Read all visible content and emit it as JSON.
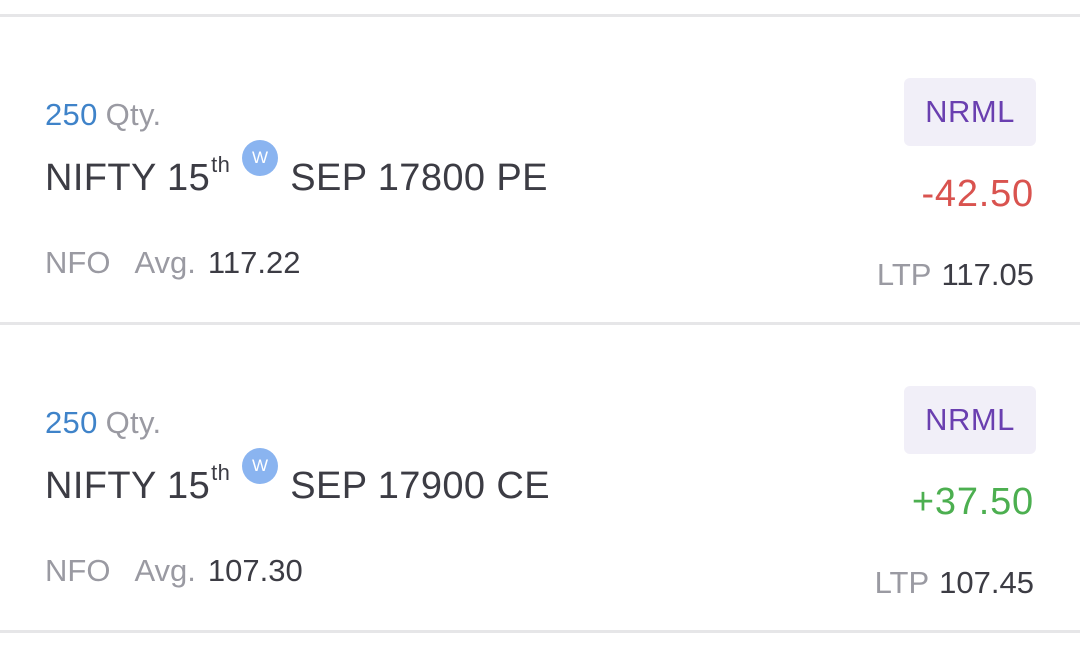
{
  "positions": [
    {
      "qty": "250",
      "qty_unit": "Qty.",
      "symbol": "NIFTY 15",
      "symbol_sup": "th",
      "weekly_badge": "W",
      "contract": "SEP 17800 PE",
      "exchange": "NFO",
      "avg_label": "Avg.",
      "avg_value": "117.22",
      "product": "NRML",
      "pnl": "-42.50",
      "ltp_label": "LTP",
      "ltp_value": "117.05"
    },
    {
      "qty": "250",
      "qty_unit": "Qty.",
      "symbol": "NIFTY 15",
      "symbol_sup": "th",
      "weekly_badge": "W",
      "contract": "SEP 17900 CE",
      "exchange": "NFO",
      "avg_label": "Avg.",
      "avg_value": "107.30",
      "product": "NRML",
      "pnl": "+37.50",
      "ltp_label": "LTP",
      "ltp_value": "107.45"
    }
  ],
  "colors": {
    "qty": "#3f83c9",
    "muted": "#9a9aa2",
    "text": "#3c3c44",
    "product_text": "#6a3fb0",
    "product_bg": "#f1eff8",
    "loss": "#d9534f",
    "profit": "#4caf50",
    "weekly_badge": "#8ab4f0"
  }
}
